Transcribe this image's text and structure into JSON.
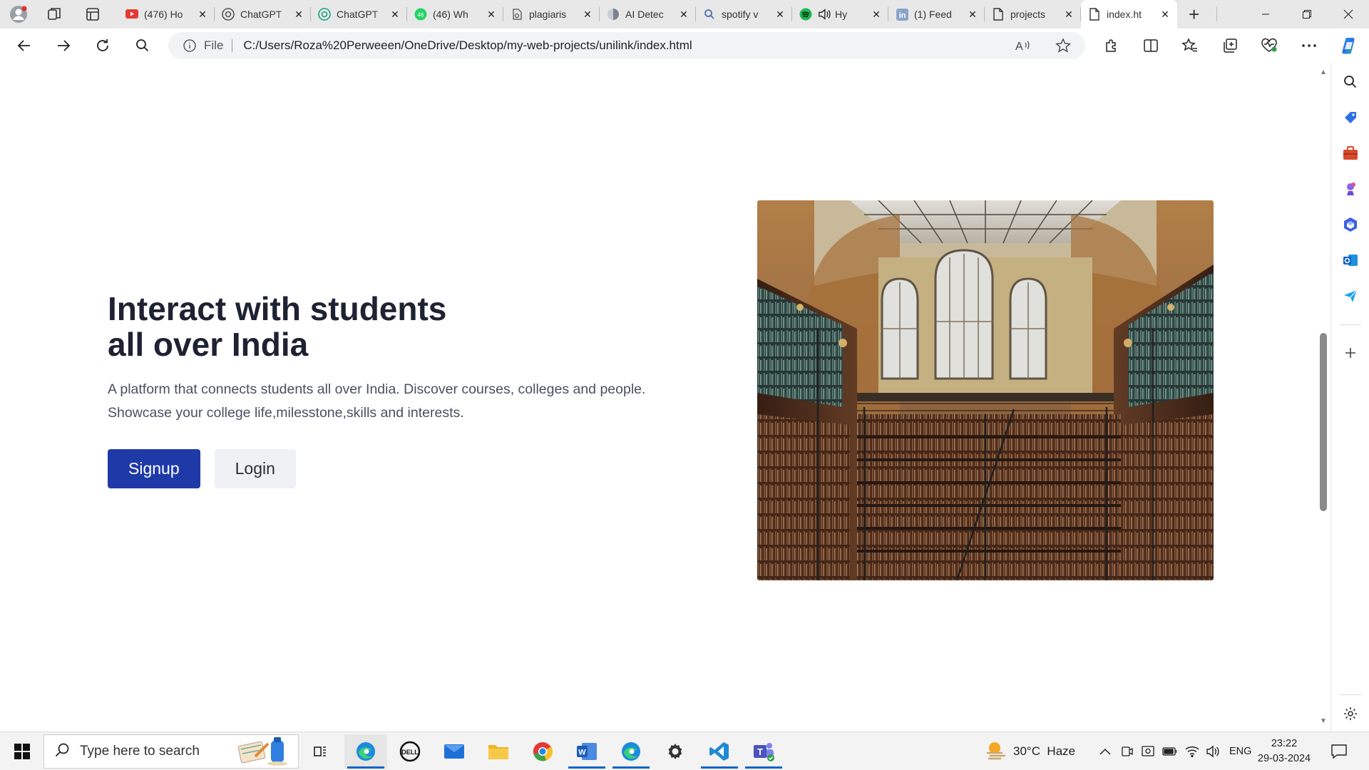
{
  "browser": {
    "tabs": [
      {
        "title": "(476) Ho",
        "icon": "youtube-icon",
        "active": false
      },
      {
        "title": "ChatGPT",
        "icon": "chatgpt-icon",
        "active": false
      },
      {
        "title": "ChatGPT",
        "icon": "chatgpt-icon",
        "active": false
      },
      {
        "title": "(46) Wh",
        "icon": "whatsapp-icon",
        "active": false
      },
      {
        "title": "plagiaris",
        "icon": "web-icon",
        "active": false
      },
      {
        "title": "AI Detec",
        "icon": "web-icon",
        "active": false
      },
      {
        "title": "spotify v",
        "icon": "search-icon",
        "active": false
      },
      {
        "title": "Hy",
        "icon": "spotify-icon",
        "active": false
      },
      {
        "title": "(1) Feed",
        "icon": "linkedin-icon",
        "active": false
      },
      {
        "title": "projects",
        "icon": "file-icon",
        "active": false
      },
      {
        "title": "index.ht",
        "icon": "file-icon",
        "active": true
      }
    ],
    "address": {
      "scheme": "File",
      "url": "C:/Users/Roza%20Perweeen/OneDrive/Desktop/my-web-projects/unilink/index.html"
    }
  },
  "page": {
    "hero": {
      "title_line1": "Interact with students",
      "title_line2": "all over India",
      "description_line1": "A platform that connects students all over India. Discover courses, colleges and people.",
      "description_line2": "Showcase your college life,milesstone,skills and interests.",
      "signup_label": "Signup",
      "login_label": "Login",
      "image_subject": "library hall with bookshelves and arched windows"
    }
  },
  "taskbar": {
    "search_placeholder": "Type here to search",
    "weather": "30°C  Haze",
    "language": "ENG",
    "time": "23:22",
    "date": "29-03-2024"
  },
  "colors": {
    "primary_button": "#1e3aa8",
    "secondary_button": "#f0f1f4",
    "title_text": "#1e2233"
  }
}
